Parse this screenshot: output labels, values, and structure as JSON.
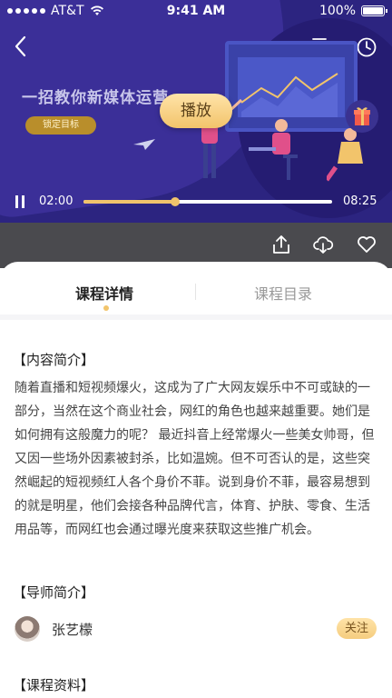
{
  "status_bar": {
    "carrier": "AT&T",
    "time": "9:41 AM",
    "battery": "100%"
  },
  "video": {
    "banner_title": "一招教你新媒体运营",
    "banner_tag": "锁定目标",
    "play_label": "播放",
    "current_time": "02:00",
    "total_time": "08:25",
    "progress": 0.37
  },
  "tabs": [
    {
      "label": "课程详情",
      "active": true
    },
    {
      "label": "课程目录",
      "active": false
    }
  ],
  "intro": {
    "title": "【内容简介】",
    "body": "随着直播和短视频爆火，这成为了广大网友娱乐中不可或缺的一部分，当然在这个商业社会，网红的角色也越来越重要。她们是如何拥有这般魔力的呢？ 最近抖音上经常爆火一些美女帅哥，但又因一些场外因素被封杀，比如温婉。但不可否认的是，这些突然崛起的短视频红人各个身价不菲。说到身价不菲，最容易想到的就是明星，他们会接各种品牌代言，体育、护肤、零食、生活用品等，而网红也会通过曝光度来获取这些推广机会。"
  },
  "teacher": {
    "title": "【导师简介】",
    "name": "张艺檬",
    "follow_label": "关注"
  },
  "materials": {
    "title": "【课程资料】"
  },
  "colors": {
    "accent": "#f2c46b",
    "hero": "#2c2480",
    "action_bar": "#4a4a4e"
  }
}
